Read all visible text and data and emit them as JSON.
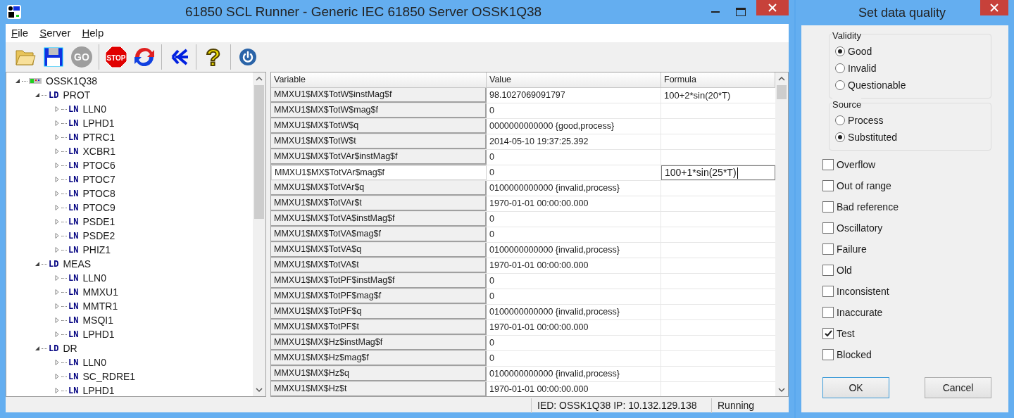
{
  "window": {
    "title": "61850 SCL Runner - Generic IEC 61850 Server OSSK1Q38"
  },
  "menu": [
    {
      "label": "File"
    },
    {
      "label": "Server"
    },
    {
      "label": "Help"
    }
  ],
  "toolbar": [
    [
      {
        "kind": "open",
        "disabled": false
      },
      {
        "kind": "save",
        "disabled": false
      },
      {
        "kind": "go",
        "label": "GO",
        "disabled": true
      }
    ],
    [
      {
        "kind": "stop",
        "label": "STOP",
        "disabled": false
      },
      {
        "kind": "restart",
        "disabled": false
      }
    ],
    [
      {
        "kind": "branch",
        "disabled": false
      }
    ],
    [
      {
        "kind": "help",
        "label": "?",
        "disabled": false
      }
    ],
    [
      {
        "kind": "power",
        "disabled": false
      }
    ]
  ],
  "tree": [
    {
      "name": "OSSK1Q38",
      "expanded": true,
      "children": [
        {
          "tag": "LD",
          "name": "PROT",
          "expanded": true,
          "children": [
            {
              "tag": "LN",
              "name": "LLN0",
              "expanded": false
            },
            {
              "tag": "LN",
              "name": "LPHD1",
              "expanded": false
            },
            {
              "tag": "LN",
              "name": "PTRC1",
              "expanded": false
            },
            {
              "tag": "LN",
              "name": "XCBR1",
              "expanded": false
            },
            {
              "tag": "LN",
              "name": "PTOC6",
              "expanded": false
            },
            {
              "tag": "LN",
              "name": "PTOC7",
              "expanded": false
            },
            {
              "tag": "LN",
              "name": "PTOC8",
              "expanded": false
            },
            {
              "tag": "LN",
              "name": "PTOC9",
              "expanded": false
            },
            {
              "tag": "LN",
              "name": "PSDE1",
              "expanded": false
            },
            {
              "tag": "LN",
              "name": "PSDE2",
              "expanded": false
            },
            {
              "tag": "LN",
              "name": "PHIZ1",
              "expanded": false
            }
          ]
        },
        {
          "tag": "LD",
          "name": "MEAS",
          "expanded": true,
          "children": [
            {
              "tag": "LN",
              "name": "LLN0",
              "expanded": false
            },
            {
              "tag": "LN",
              "name": "MMXU1",
              "expanded": false
            },
            {
              "tag": "LN",
              "name": "MMTR1",
              "expanded": false
            },
            {
              "tag": "LN",
              "name": "MSQI1",
              "expanded": false
            },
            {
              "tag": "LN",
              "name": "LPHD1",
              "expanded": false
            }
          ]
        },
        {
          "tag": "LD",
          "name": "DR",
          "expanded": true,
          "children": [
            {
              "tag": "LN",
              "name": "LLN0",
              "expanded": false
            },
            {
              "tag": "LN",
              "name": "SC_RDRE1",
              "expanded": false
            },
            {
              "tag": "LN",
              "name": "LPHD1",
              "expanded": false
            }
          ]
        }
      ]
    }
  ],
  "table": {
    "columns": [
      "Variable",
      "Value",
      "Formula"
    ],
    "rows": [
      {
        "variable": "MMXU1$MX$TotW$instMag$f",
        "value": "98.1027069091797",
        "formula": "100+2*sin(20*T)",
        "selected": false
      },
      {
        "variable": "MMXU1$MX$TotW$mag$f",
        "value": "0",
        "selected": false
      },
      {
        "variable": "MMXU1$MX$TotW$q",
        "value": "0000000000000 {good,process}",
        "selected": false
      },
      {
        "variable": "MMXU1$MX$TotW$t",
        "value": "2014-05-10 19:37:25.392",
        "selected": false
      },
      {
        "variable": "MMXU1$MX$TotVAr$instMag$f",
        "value": "0",
        "selected": false
      },
      {
        "variable": "MMXU1$MX$TotVAr$mag$f",
        "value": "0",
        "formula": "100+1*sin(25*T)",
        "selected": true
      },
      {
        "variable": "MMXU1$MX$TotVAr$q",
        "value": "0100000000000 {invalid,process}",
        "selected": false
      },
      {
        "variable": "MMXU1$MX$TotVAr$t",
        "value": "1970-01-01 00:00:00.000",
        "selected": false
      },
      {
        "variable": "MMXU1$MX$TotVA$instMag$f",
        "value": "0",
        "selected": false
      },
      {
        "variable": "MMXU1$MX$TotVA$mag$f",
        "value": "0",
        "selected": false
      },
      {
        "variable": "MMXU1$MX$TotVA$q",
        "value": "0100000000000 {invalid,process}",
        "selected": false
      },
      {
        "variable": "MMXU1$MX$TotVA$t",
        "value": "1970-01-01 00:00:00.000",
        "selected": false
      },
      {
        "variable": "MMXU1$MX$TotPF$instMag$f",
        "value": "0",
        "selected": false
      },
      {
        "variable": "MMXU1$MX$TotPF$mag$f",
        "value": "0",
        "selected": false
      },
      {
        "variable": "MMXU1$MX$TotPF$q",
        "value": "0100000000000 {invalid,process}",
        "selected": false
      },
      {
        "variable": "MMXU1$MX$TotPF$t",
        "value": "1970-01-01 00:00:00.000",
        "selected": false
      },
      {
        "variable": "MMXU1$MX$Hz$instMag$f",
        "value": "0",
        "selected": false
      },
      {
        "variable": "MMXU1$MX$Hz$mag$f",
        "value": "0",
        "selected": false
      },
      {
        "variable": "MMXU1$MX$Hz$q",
        "value": "0100000000000 {invalid,process}",
        "selected": false
      },
      {
        "variable": "MMXU1$MX$Hz$t",
        "value": "1970-01-01 00:00:00.000",
        "selected": false
      }
    ]
  },
  "status_bar": {
    "connection": "IED: OSSK1Q38 IP: 10.132.129.138",
    "state": "Running"
  },
  "dialog": {
    "title": "Set data quality",
    "groups": [
      {
        "title": "Validity",
        "options": [
          {
            "label": "Good",
            "selected": true
          },
          {
            "label": "Invalid",
            "selected": false
          },
          {
            "label": "Questionable",
            "selected": false
          }
        ]
      },
      {
        "title": "Source",
        "options": [
          {
            "label": "Process",
            "selected": false
          },
          {
            "label": "Substituted",
            "selected": true
          }
        ]
      }
    ],
    "flags": [
      {
        "label": "Overflow",
        "checked": false
      },
      {
        "label": "Out of range",
        "checked": false
      },
      {
        "label": "Bad reference",
        "checked": false
      },
      {
        "label": "Oscillatory",
        "checked": false
      },
      {
        "label": "Failure",
        "checked": false
      },
      {
        "label": "Old",
        "checked": false
      },
      {
        "label": "Inconsistent",
        "checked": false
      },
      {
        "label": "Inaccurate",
        "checked": false
      },
      {
        "label": "Test",
        "checked": true
      },
      {
        "label": "Blocked",
        "checked": false
      }
    ],
    "buttons": [
      {
        "label": "OK",
        "default": true
      },
      {
        "label": "Cancel",
        "default": false
      }
    ]
  }
}
